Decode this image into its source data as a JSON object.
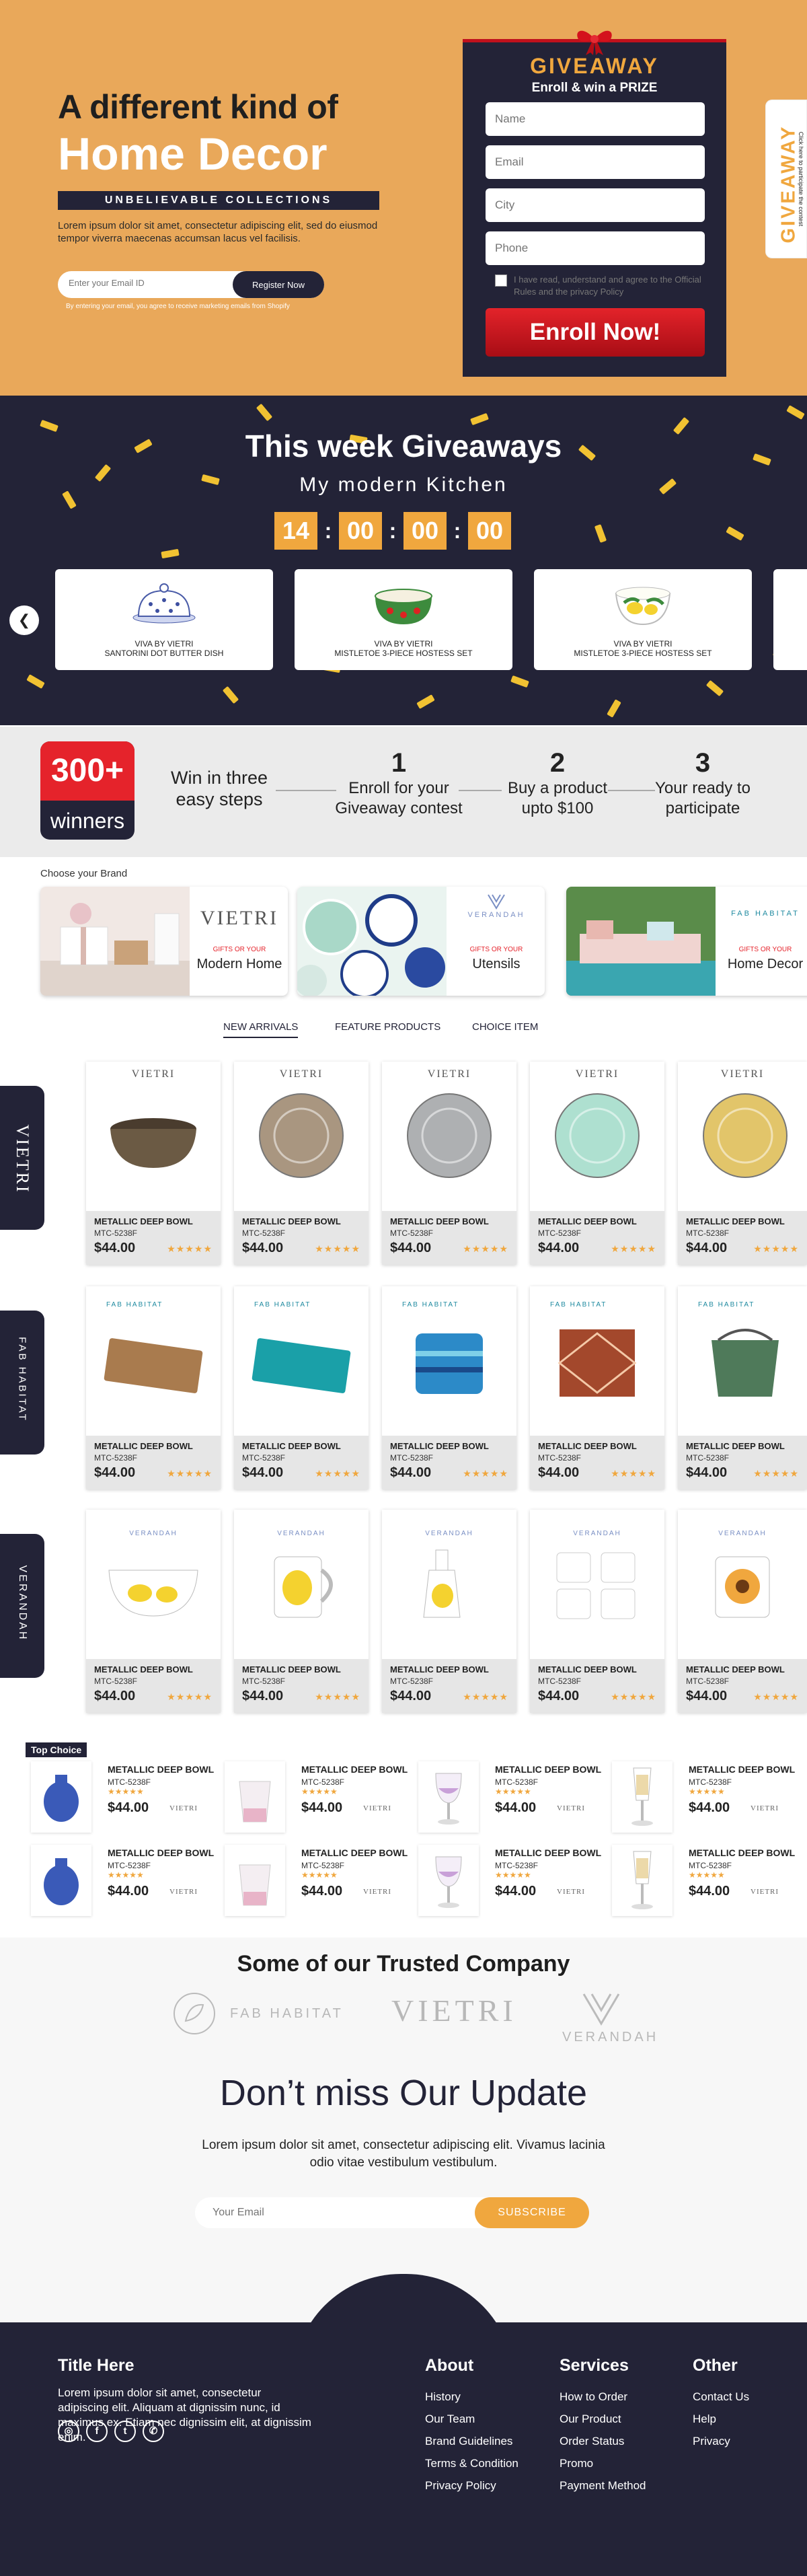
{
  "hero": {
    "line1": "A different kind of",
    "line2": "Home Decor",
    "tagline": "UNBELIEVABLE COLLECTIONS",
    "text": "Lorem ipsum dolor sit amet, consectetur adipiscing elit, sed do eiusmod tempor viverra maecenas accumsan lacus vel facilisis.",
    "email_placeholder": "Enter your Email ID",
    "register_label": "Register Now",
    "consent": "By entering your email, you agree to receive marketing emails from Shopify"
  },
  "giveaway": {
    "title": "GIVEAWAY",
    "subtitle": "Enroll & win a PRIZE",
    "name_placeholder": "Name",
    "email_placeholder": "Email",
    "city_placeholder": "City",
    "phone_placeholder": "Phone",
    "agree": "I have read, understand and agree to the Official Rules and the privacy Policy",
    "enroll_label": "Enroll Now!",
    "side_title": "GIVEAWAY",
    "side_sub": "Click here to participate the contest"
  },
  "week": {
    "title": "This week Giveaways",
    "subtitle": "My modern Kitchen",
    "timer": [
      "14",
      "00",
      "00",
      "00"
    ],
    "products": [
      {
        "brand": "VIVA BY VIETRI",
        "name": "SANTORINI DOT BUTTER DISH"
      },
      {
        "brand": "VIVA BY VIETRI",
        "name": "MISTLETOE 3-PIECE HOSTESS SET"
      },
      {
        "brand": "VIVA BY VIETRI",
        "name": "MISTLETOE 3-PIECE HOSTESS SET"
      }
    ]
  },
  "steps": {
    "count": "300+",
    "winners": "winners",
    "intro": "Win in three easy steps",
    "items": [
      {
        "n": "1",
        "t": "Enroll for your Giveaway contest"
      },
      {
        "n": "2",
        "t": "Buy a product upto $100"
      },
      {
        "n": "3",
        "t": "Your ready to participate"
      }
    ]
  },
  "brands": {
    "heading": "Choose your Brand",
    "items": [
      {
        "logo": "VIETRI",
        "gifts": "GIFTS OR YOUR",
        "name": "Modern Home"
      },
      {
        "logo": "VERANDAH",
        "gifts": "GIFTS OR YOUR",
        "name": "Utensils"
      },
      {
        "logo": "FAB HABITAT",
        "gifts": "GIFTS OR YOUR",
        "name": "Home Decor"
      }
    ]
  },
  "tabs": [
    "NEW ARRIVALS",
    "FEATURE PRODUCTS",
    "CHOICE ITEM"
  ],
  "side_brands": [
    "VIETRI",
    "FAB HABITAT",
    "VERANDAH"
  ],
  "product": {
    "name": "METALLIC DEEP BOWL",
    "code": "MTC-5238F",
    "price": "$44.00",
    "stars": "★★★★★"
  },
  "grid_brands": [
    "VIETRI",
    "FAB HABITAT",
    "VERANDAH"
  ],
  "top_choice": {
    "label": "Top Choice",
    "brand": "VIETRI"
  },
  "trusted": {
    "title": "Some of our Trusted Company",
    "logos": [
      "FAB HABITAT",
      "VIETRI",
      "VERANDAH"
    ]
  },
  "update": {
    "title": "Don’t miss Our Update",
    "text": "Lorem ipsum dolor sit amet, consectetur adipiscing elit. Vivamus lacinia odio vitae vestibulum vestibulum.",
    "email_placeholder": "Your Email",
    "subscribe_label": "SUBSCRIBE"
  },
  "footer": {
    "title": "Title Here",
    "text": "Lorem ipsum dolor sit amet, consectetur adipiscing elit. Aliquam at dignissim nunc, id maximus ex. Etiam nec dignissim elit, at dignissim enim.",
    "about_title": "About",
    "about": [
      "History",
      "Our Team",
      "Brand Guidelines",
      "Terms & Condition",
      "Privacy Policy"
    ],
    "services_title": "Services",
    "services": [
      "How to Order",
      "Our Product",
      "Order Status",
      "Promo",
      "Payment Method"
    ],
    "other_title": "Other",
    "other": [
      "Contact Us",
      "Help",
      "Privacy"
    ]
  },
  "colors": {
    "navy": "#232337",
    "orange": "#f0a73e",
    "red": "#e5232b",
    "hero_bg": "#e9a85a"
  }
}
